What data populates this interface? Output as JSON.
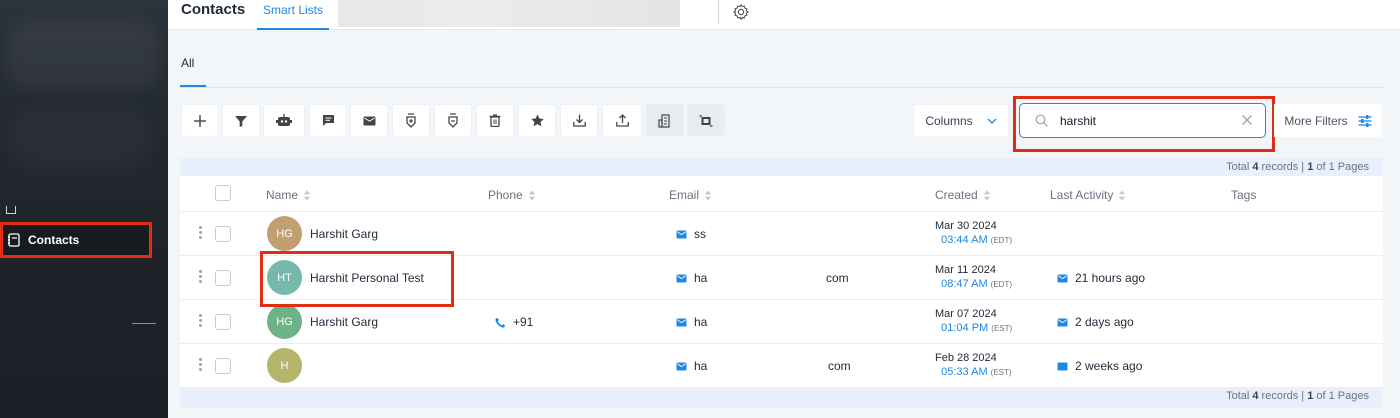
{
  "sidebar": {
    "active_item": "Contacts"
  },
  "topbar": {
    "title": "Contacts",
    "smart_lists_tab": "Smart Lists"
  },
  "tabs": {
    "all": "All"
  },
  "toolbar": {
    "buttons": [
      "add-icon",
      "filter-icon",
      "bot-icon",
      "message-icon",
      "email-icon",
      "add-tag-icon",
      "remove-tag-icon",
      "delete-icon",
      "star-icon",
      "download-icon",
      "upload-icon",
      "building-icon",
      "merge-icon"
    ],
    "columns_label": "Columns",
    "search_value": "harshit",
    "more_filters_label": "More Filters"
  },
  "summary": {
    "prefix": "Total ",
    "count": "4",
    "mid": " records | ",
    "page": "1",
    "suffix": " of 1 Pages"
  },
  "table": {
    "headers": {
      "name": "Name",
      "phone": "Phone",
      "email": "Email",
      "created": "Created",
      "last_activity": "Last Activity",
      "tags": "Tags"
    },
    "rows": [
      {
        "initials": "HG",
        "avatar_color": "#c29f72",
        "name": "Harshit Garg",
        "phone": "",
        "email": "ss",
        "email_end": "",
        "created_date": "Mar 30 2024",
        "created_time": "03:44 AM",
        "tz": "(EDT)",
        "activity": ""
      },
      {
        "initials": "HT",
        "avatar_color": "#76b8ac",
        "name": "Harshit Personal Test",
        "phone": "",
        "email": "ha",
        "email_end": "com",
        "created_date": "Mar 11 2024",
        "created_time": "08:47 AM",
        "tz": "(EDT)",
        "activity": "21 hours ago"
      },
      {
        "initials": "HG",
        "avatar_color": "#6db387",
        "name": "Harshit Garg",
        "phone": "+91",
        "email": "ha",
        "email_end": "",
        "created_date": "Mar 07 2024",
        "created_time": "01:04 PM",
        "tz": "(EST)",
        "activity": "2 days ago"
      },
      {
        "initials": "H",
        "avatar_color": "#b5b66c",
        "name": "",
        "phone": "",
        "email": "ha",
        "email_end": "com",
        "created_date": "Feb 28 2024",
        "created_time": "05:33 AM",
        "tz": "(EST)",
        "activity": "2 weeks ago"
      }
    ]
  },
  "colors": {
    "accent": "#1e88e5",
    "highlight": "#e32c16"
  }
}
